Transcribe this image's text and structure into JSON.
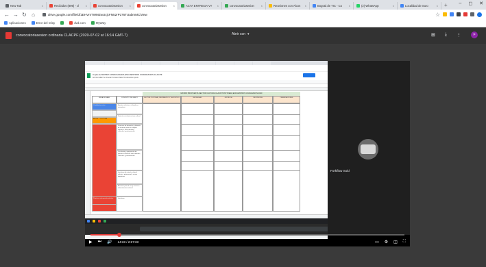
{
  "browser": {
    "tabs": [
      {
        "label": "New Tab",
        "color": "#5f6368"
      },
      {
        "label": "Recibidos (896) - cl",
        "color": "#ea4335"
      },
      {
        "label": "convocatoriasesion",
        "color": "#ea4335"
      },
      {
        "label": "convocatoriasesion",
        "color": "#ea4335",
        "active": true
      },
      {
        "label": "ACTA ENTREGA VT",
        "color": "#34a853"
      },
      {
        "label": "convocatoriasesion",
        "color": "#34a853"
      },
      {
        "label": "Reuniones con Alcon",
        "color": "#fbbc04"
      },
      {
        "label": "Bogotá de TIC - Co",
        "color": "#4285f4"
      },
      {
        "label": "(2) WhatsApp",
        "color": "#25d366"
      },
      {
        "label": "Localidad de Suro",
        "color": "#4285f4"
      }
    ],
    "new_tab": "+",
    "window_controls": [
      "–",
      "◻",
      "✕"
    ],
    "url": "drive.google.com/file/d/1EHVrsTWMZwUcjcFN52rPz76TUabmMC/view",
    "bookmarks": [
      {
        "label": "Aplicaciones",
        "color": "#4285f4"
      },
      {
        "label": "Error del relay",
        "color": "#4285f4"
      },
      {
        "label": "",
        "color": "#34a853"
      },
      {
        "label": "dvd.com",
        "color": "#ea4335"
      },
      {
        "label": "MyWay",
        "color": "#34a853"
      }
    ],
    "extension_colors": [
      "#fbbc04",
      "#4285f4",
      "#3c4043",
      "#e53935",
      "#5f6368",
      "#1a73e8"
    ]
  },
  "viewer": {
    "title": "convocatoriasesion ordinaria CLACPF (2020-07-02 at 16:14 GMT-7)",
    "open_with": "Abrir con",
    "icons": [
      "comment-icon",
      "download-icon",
      "more-icon"
    ],
    "avatar_letter": "F"
  },
  "video": {
    "participant_name": "Forkflow Sold",
    "time": "14:33 / 2:37:33",
    "progress": 0.092
  },
  "sheet": {
    "doc_title": "Copia de MATRIZ CONSOLIDADA ENCUENTROS CIUDADANOS CLACPF",
    "menu": "Archivo  Editar  Ver  Insertar  Formato  Datos  Herramientas  Ayuda",
    "banner": "MATRIZ PROPUESTA SECTOR CULTURA CLACP PONTIVIERA ENCUENTROS CIUDADANOS 2020",
    "headers": [
      "LINEA DE BASE",
      "CONCEPTO DE GASTO",
      "SECTOR CULTURAL, RECREATIVO Y DEPORTIVO",
      "NECESIDAD",
      "JUSTIFICA",
      "PROPUESTA",
      "OBSERVACIONES"
    ],
    "col_a": [
      "Ciudadanía activa",
      "ARTES Y CULTURA",
      "Prácticas y formación artística"
    ],
    "col_b": [
      "Eventos artísticos, culturales y recreativos",
      "Dotación e infraestructura cultural",
      "Procesos de formación y dotación de insumos para los campos artísticos, interculturales, culturales y patrimoniales",
      "Circulación y apropiación de prácticas artísticas interculturales, culturales y patrimoniales",
      "Iniciativas de interés cultural, artístico, patrimonial y recreo deportivas",
      "Acciones para el uso y acceso a infraestructura cultural",
      "Iniciativas"
    ]
  }
}
